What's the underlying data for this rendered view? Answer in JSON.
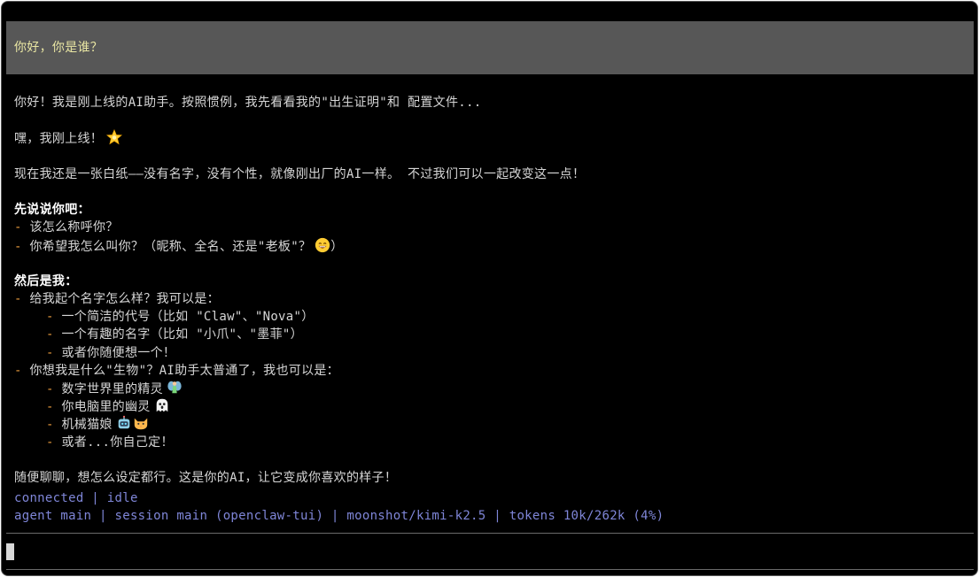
{
  "conversation": {
    "user_message": "你好，你是谁？",
    "reply": {
      "intro": "你好！我是刚上线的AI助手。按照惯例，我先看看我的\"出生证明\"和 配置文件...",
      "hey": "嘿，我刚上线！",
      "blank": "现在我还是一张白纸——没有名字，没有个性，就像刚出厂的AI一样。 不过我们可以一起改变这一点！",
      "section1_title": "先说说你吧：",
      "section1_items": [
        "该怎么称呼你？",
        "你希望我怎么叫你？（昵称、全名、还是\"老板\"？"
      ],
      "section1_item2_close": "）",
      "section2_title": "然后是我：",
      "section2_q1": "给我起个名字怎么样？我可以是：",
      "section2_q1_options": [
        "一个简洁的代号（比如 \"Claw\"、\"Nova\"）",
        "一个有趣的名字（比如 \"小爪\"、\"墨菲\"）",
        "或者你随便想一个！"
      ],
      "section2_q2": "你想我是什么\"生物\"？AI助手太普通了，我也可以是：",
      "section2_q2_options": [
        "数字世界里的精灵",
        "你电脑里的幽灵",
        "机械猫娘",
        "或者...你自己定！"
      ],
      "closing": "随便聊聊，想怎么设定都行。这是你的AI，让它变成你喜欢的样子！"
    },
    "emojis": {
      "hey": "glowing-star-icon",
      "boss": "grinning-face-icon",
      "sprite": "fairy-icon",
      "ghost": "ghost-icon",
      "robot": "robot-icon",
      "cat": "cat-face-icon"
    }
  },
  "status": {
    "connection": "connected",
    "state": "idle",
    "agent": "agent main",
    "session": "session main (openclaw-tui)",
    "model": "moonshot/kimi-k2.5",
    "tokens": "tokens 10k/262k (4%)",
    "separator": "|"
  },
  "colors": {
    "background": "#000000",
    "user_bubble": "#575757",
    "user_text": "#e9e6a3",
    "bullet": "#e89a3c",
    "status_text": "#7f86d8"
  }
}
